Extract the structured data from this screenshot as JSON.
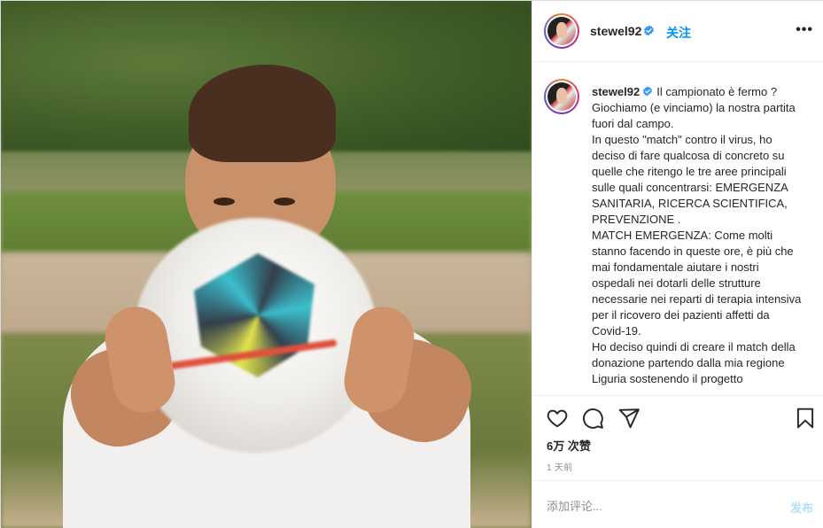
{
  "header": {
    "username": "stewel92",
    "follow_label": "关注",
    "more_label": "•••"
  },
  "caption": {
    "username": "stewel92",
    "text": "Il campionato è fermo ?\nGiochiamo (e vinciamo) la nostra partita fuori dal campo.\nIn questo \"match\" contro il virus, ho deciso di fare qualcosa di concreto su quelle che ritengo le tre aree principali sulle quali concentrarsi: EMERGENZA SANITARIA, RICERCA SCIENTIFICA, PREVENZIONE .\nMATCH EMERGENZA: Come molti stanno facendo in queste ore, è più che mai fondamentale aiutare i nostri ospedali nei dotarli delle strutture necessarie nei reparti di terapia intensiva per il ricovero dei pazienti affetti da Covid-19.\nHo deciso quindi di creare il match della donazione partendo dalla mia regione Liguria sostenendo il progetto"
  },
  "actions": {
    "like_icon": "heart-icon",
    "comment_icon": "comment-icon",
    "share_icon": "paper-plane-icon",
    "save_icon": "bookmark-icon"
  },
  "likes": "6万 次赞",
  "time_ago": "1 天前",
  "comment": {
    "placeholder": "添加评论...",
    "post_label": "发布"
  },
  "colors": {
    "accent": "#0095f6",
    "verified": "#3897f0",
    "text": "#262626",
    "muted": "#8e8e8e",
    "post_disabled": "#b2dffc"
  }
}
